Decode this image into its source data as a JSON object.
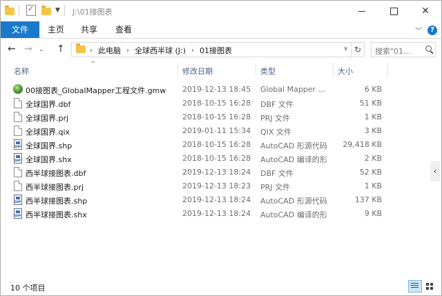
{
  "window": {
    "title": "J:\\01接图表"
  },
  "ribbon": {
    "tabs": [
      "文件",
      "主页",
      "共享",
      "查看"
    ]
  },
  "nav": {
    "breadcrumbs": [
      "此电脑",
      "全球西半球 (J:)",
      "01接图表"
    ],
    "search_placeholder": "搜索\"01..."
  },
  "columns": {
    "name": "名称",
    "date": "修改日期",
    "type": "类型",
    "size": "大小"
  },
  "files": [
    {
      "name": "00接图表_GlobalMapper工程文件.gmw",
      "date": "2019-12-13 18:45",
      "type": "Global Mapper ...",
      "size": "6 KB",
      "icon": "globalmapper-icon"
    },
    {
      "name": "全球国界.dbf",
      "date": "2018-10-15 16:28",
      "type": "DBF 文件",
      "size": "51 KB",
      "icon": "file-icon"
    },
    {
      "name": "全球国界.prj",
      "date": "2018-10-15 16:28",
      "type": "PRJ 文件",
      "size": "1 KB",
      "icon": "file-icon"
    },
    {
      "name": "全球国界.qix",
      "date": "2019-01-11 15:34",
      "type": "QIX 文件",
      "size": "3 KB",
      "icon": "file-icon"
    },
    {
      "name": "全球国界.shp",
      "date": "2018-10-15 16:28",
      "type": "AutoCAD 形源代码",
      "size": "29,418 KB",
      "icon": "shp-icon"
    },
    {
      "name": "全球国界.shx",
      "date": "2018-10-15 16:28",
      "type": "AutoCAD 编译的形",
      "size": "2 KB",
      "icon": "shp-icon"
    },
    {
      "name": "西半球接图表.dbf",
      "date": "2019-12-13 18:24",
      "type": "DBF 文件",
      "size": "52 KB",
      "icon": "file-icon"
    },
    {
      "name": "西半球接图表.prj",
      "date": "2019-12-13 18:23",
      "type": "PRJ 文件",
      "size": "1 KB",
      "icon": "file-icon"
    },
    {
      "name": "西半球接图表.shp",
      "date": "2019-12-13 18:24",
      "type": "AutoCAD 形源代码",
      "size": "137 KB",
      "icon": "shp-icon"
    },
    {
      "name": "西半球接图表.shx",
      "date": "2019-12-13 18:24",
      "type": "AutoCAD 编译的形",
      "size": "9 KB",
      "icon": "shp-icon"
    }
  ],
  "status": {
    "item_count": "10 个项目"
  },
  "colors": {
    "accent": "#1979ca",
    "header_text": "#4d6185"
  }
}
